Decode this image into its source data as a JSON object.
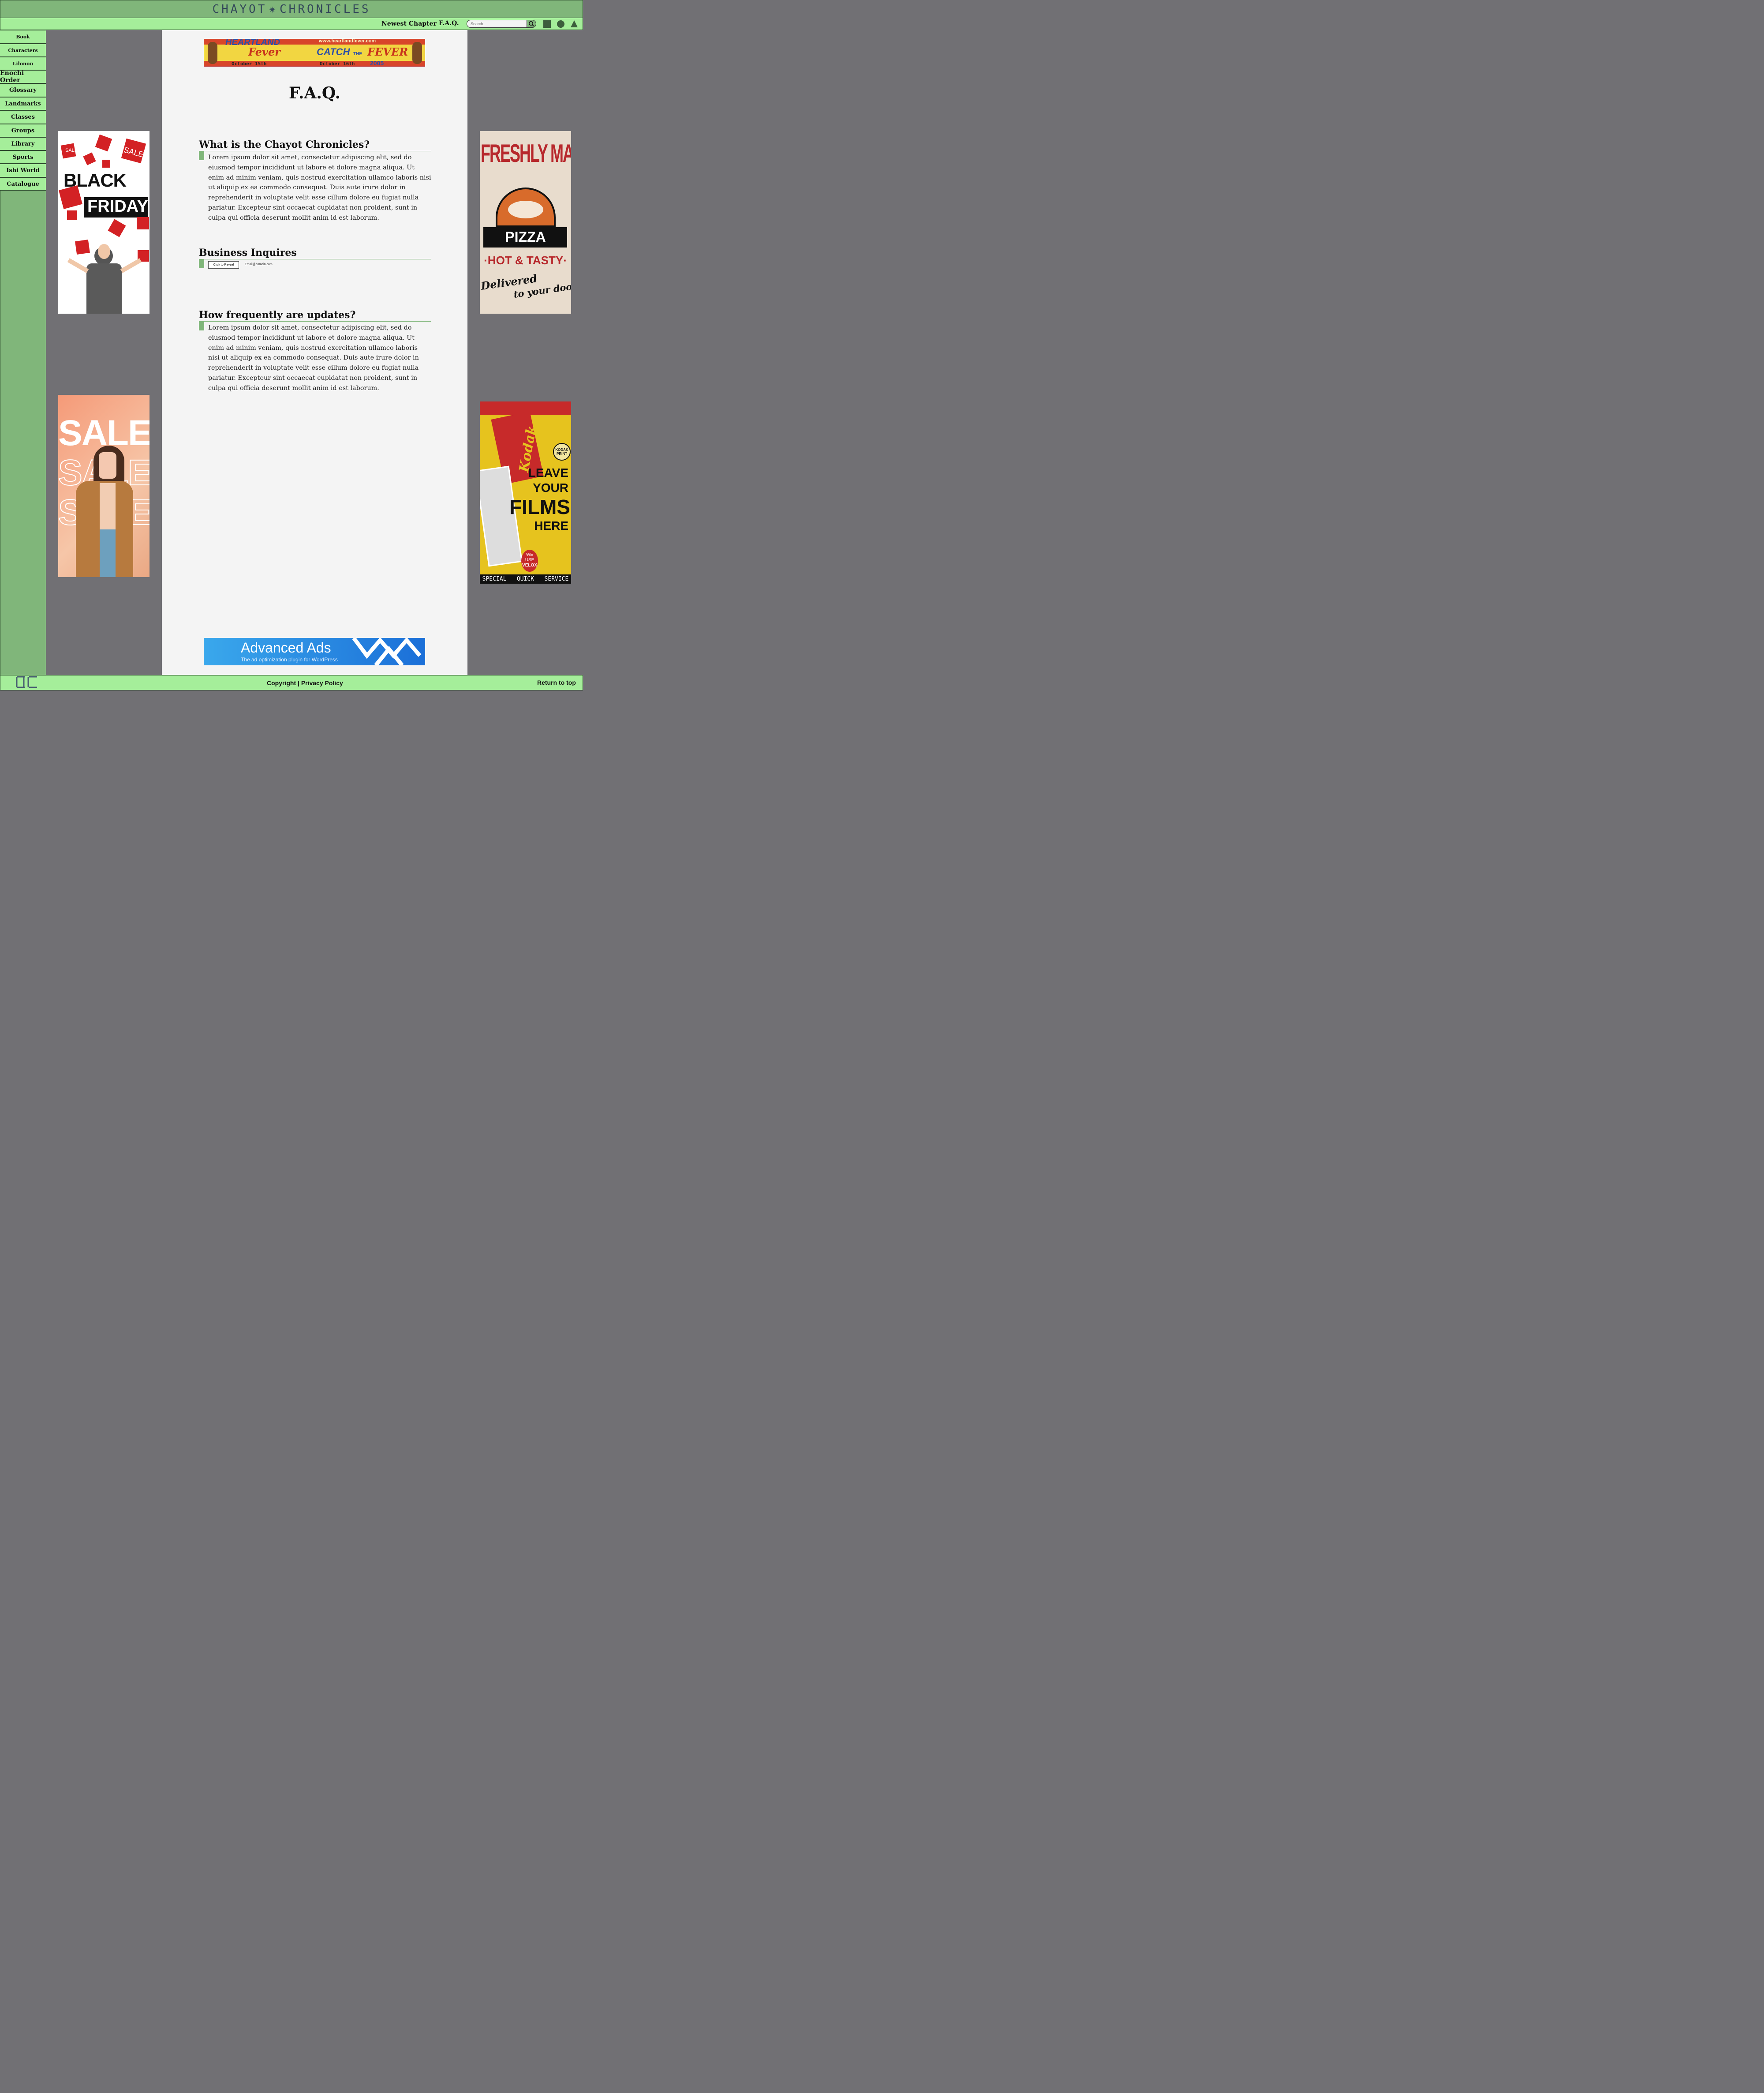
{
  "header": {
    "title_left": "CHAYOT",
    "title_right": "CHRONICLES"
  },
  "nav": {
    "newest_chapter": "Newest Chapter",
    "faq": "F.A.Q.",
    "search_placeholder": "Search..."
  },
  "sidebar": {
    "items": [
      {
        "label": "Book"
      },
      {
        "label": "Characters"
      },
      {
        "label": "Lilonon"
      },
      {
        "label": "Enochi Order"
      },
      {
        "label": "Glossary"
      },
      {
        "label": "Landmarks"
      },
      {
        "label": "Classes"
      },
      {
        "label": "Groups"
      },
      {
        "label": "Library"
      },
      {
        "label": "Sports"
      },
      {
        "label": "Ishi World"
      },
      {
        "label": "Catalogue"
      }
    ]
  },
  "page": {
    "title": "F.A.Q.",
    "sections": [
      {
        "title": "What is the Chayot Chronicles?",
        "body": "Lorem ipsum dolor sit amet, consectetur adipiscing elit, sed do eiusmod tempor incididunt ut labore et dolore magna aliqua. Ut enim ad minim veniam, quis nostrud exercitation ullamco laboris nisi ut aliquip ex ea commodo consequat. Duis aute irure dolor in reprehenderit in voluptate velit esse cillum dolore eu fugiat nulla pariatur. Excepteur sint occaecat cupidatat non proident, sunt in culpa qui officia deserunt mollit anim id est laborum."
      },
      {
        "title": "Business Inquires",
        "reveal_button": "Click to Reveal",
        "email": "Email@domain.com"
      },
      {
        "title": "How frequently are updates?",
        "body": "Lorem ipsum dolor sit amet, consectetur adipiscing elit, sed do eiusmod tempor incididunt ut labore et dolore magna aliqua. Ut enim ad minim veniam, quis nostrud exercitation ullamco laboris nisi ut aliquip ex ea commodo consequat. Duis aute irure dolor in reprehenderit in voluptate velit esse cillum dolore eu fugiat nulla pariatur. Excepteur sint occaecat cupidatat non proident, sunt in culpa qui officia deserunt mollit anim id est laborum."
      }
    ]
  },
  "ads": {
    "top_banner": {
      "line1": "HEARTLAND",
      "line2": "Fever",
      "url": "www.heartlandfever.com",
      "tagline_a": "CATCH",
      "tagline_b": "THE",
      "tagline_c": "FEVER",
      "date1": "October 15th",
      "date2": "October 16th",
      "year": "2005"
    },
    "left_top": {
      "word1": "BLACK",
      "word2": "FRIDAY",
      "sale": "SALE"
    },
    "left_bottom": {
      "word": "SALE"
    },
    "right_top": {
      "line1": "FRESHLY MADE",
      "line2": "PIZZA",
      "line3": "·HOT & TASTY·",
      "line4": "Delivered",
      "line5": "to your door"
    },
    "right_bottom": {
      "brand": "Kodak",
      "line1": "LEAVE",
      "line2": "YOUR",
      "line3": "FILMS",
      "line4": "HERE",
      "badge1": "WE",
      "badge2": "USE",
      "badge3": "VELOX",
      "footer": "SPECIAL   QUICK   SERVICE",
      "logo": "KODAK PRINT"
    },
    "bottom_banner": {
      "title": "Advanced Ads",
      "subtitle": "The ad optimization plugin for WordPress"
    }
  },
  "footer": {
    "copyright": "Copyright",
    "separator": "|",
    "privacy": "Privacy Policy",
    "return_top": "Return to top"
  },
  "colors": {
    "header_green": "#80b67a",
    "nav_green": "#a5ee9a",
    "content_bg": "#f4f4f4",
    "page_bg": "#717074"
  }
}
